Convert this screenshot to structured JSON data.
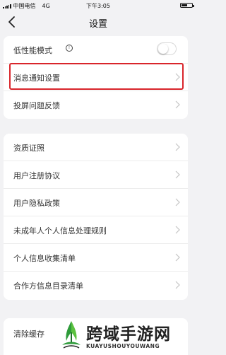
{
  "status_bar": {
    "carrier": "中国电信",
    "network": "4G",
    "time": "下午3:05",
    "battery_level": 0.55
  },
  "nav": {
    "title": "设置"
  },
  "group1": [
    {
      "label": "低性能模式",
      "toggle_on": false
    },
    {
      "label": "消息通知设置",
      "highlighted": true
    },
    {
      "label": "投屏问题反馈"
    }
  ],
  "group2": [
    {
      "label": "资质证照"
    },
    {
      "label": "用户注册协议"
    },
    {
      "label": "用户隐私政策"
    },
    {
      "label": "未成年人个人信息处理规则"
    },
    {
      "label": "个人信息收集清单"
    },
    {
      "label": "合作方信息目录清单"
    }
  ],
  "group3": [
    {
      "label": "清除缓存"
    }
  ],
  "watermark": {
    "title": "跨域手游网",
    "subtitle": "KUAYUSHOUYOUWANG"
  },
  "colors": {
    "background": "#f2f2f4",
    "highlight": "#d9252b",
    "card": "#ffffff"
  }
}
